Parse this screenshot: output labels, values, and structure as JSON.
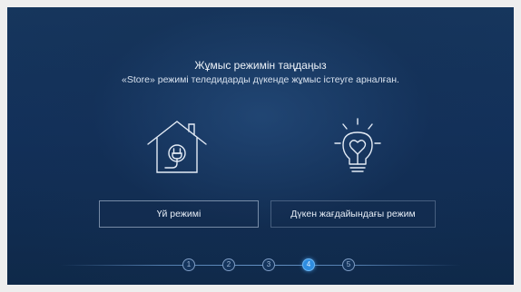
{
  "heading": {
    "title": "Жұмыс режимін таңдаңыз",
    "subtitle": "«Store» режимі теледидарды дүкенде жұмыс істеуге арналған."
  },
  "icons": {
    "home": "house-with-plug-icon",
    "store": "lightbulb-heart-icon"
  },
  "buttons": {
    "home_mode": "Үй режимі",
    "store_mode": "Дүкен жағдайындағы режим"
  },
  "stepper": {
    "steps": [
      "1",
      "2",
      "3",
      "4",
      "5"
    ],
    "current_step": 4
  },
  "colors": {
    "background": "#12305a",
    "active_step": "#2f8de0",
    "text": "#e8eef6"
  }
}
